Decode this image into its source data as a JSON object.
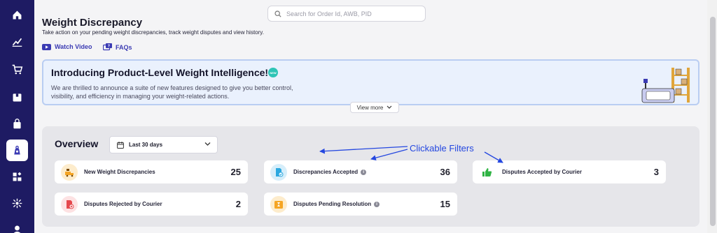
{
  "search": {
    "placeholder": "Search for Order Id, AWB, PID"
  },
  "header": {
    "title": "Weight Discrepancy",
    "subtitle": "Take action on your pending weight discrepancies, track weight disputes and view history."
  },
  "links": {
    "watch_video": "Watch Video",
    "faqs": "FAQs"
  },
  "banner": {
    "title": "Introducing Product-Level Weight Intelligence!",
    "badge": "NEW",
    "description": "We are thrilled to announce a suite of new features designed to give you better control, visibility, and efficiency in managing your weight-related actions.",
    "view_more": "View more"
  },
  "overview": {
    "title": "Overview",
    "range": "Last 30 days",
    "cards": [
      {
        "label": "New Weight Discrepancies",
        "value": "25",
        "icon": "scale-truck-icon",
        "color": "#f5a524"
      },
      {
        "label": "Discrepancies Accepted",
        "value": "36",
        "icon": "document-check-icon",
        "color": "#2aa8e0"
      },
      {
        "label": "Disputes Accepted by Courier",
        "value": "3",
        "icon": "thumbs-up-icon",
        "color": "#2fb344"
      },
      {
        "label": "Disputes Rejected by Courier",
        "value": "2",
        "icon": "document-reject-icon",
        "color": "#e5484d"
      },
      {
        "label": "Disputes Pending Resolution",
        "value": "15",
        "icon": "hourglass-box-icon",
        "color": "#f5a524"
      }
    ]
  },
  "annotation": {
    "text": "Clickable Filters",
    "color": "#2447e0"
  },
  "sidebar": {
    "items": [
      {
        "icon": "home-icon"
      },
      {
        "icon": "analytics-icon"
      },
      {
        "icon": "cart-icon"
      },
      {
        "icon": "package-icon"
      },
      {
        "icon": "shopping-bag-icon"
      },
      {
        "icon": "weight-icon",
        "active": true
      },
      {
        "icon": "apps-icon"
      },
      {
        "icon": "integrations-icon"
      },
      {
        "icon": "user-icon"
      }
    ]
  },
  "colors": {
    "sidebar": "#1e1b63",
    "accent": "#3b3bb3",
    "banner_bg": "#eaf1fd"
  }
}
